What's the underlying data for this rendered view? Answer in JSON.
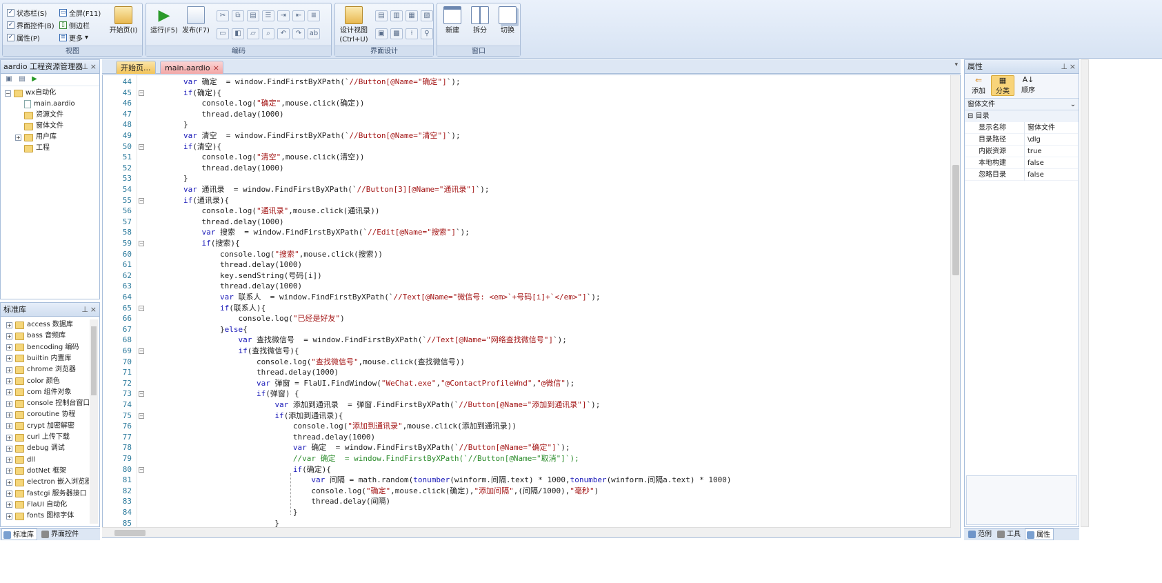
{
  "ribbon": {
    "view": {
      "title": "视图",
      "status_bar": "状态栏(S)",
      "fullscreen": "全屏(F11)",
      "ui_controls": "界面控件(B)",
      "sidebar": "侧边栏",
      "properties": "属性(P)",
      "more": "更多",
      "start_page": "开始页(I)"
    },
    "code": {
      "title": "编码",
      "run": "运行(F5)",
      "publish": "发布(F7)"
    },
    "design": {
      "title": "界面设计",
      "design_view": "设计视图",
      "design_view_key": "(Ctrl+U)"
    },
    "window": {
      "title": "窗口",
      "new": "新建",
      "split": "拆分",
      "switch": "切换"
    }
  },
  "project": {
    "title": "aardio 工程资源管理器",
    "root": "wx自动化",
    "items": [
      "main.aardio",
      "资源文件",
      "窗体文件",
      "用户库",
      "工程"
    ]
  },
  "stdlib": {
    "title": "标准库",
    "items": [
      "access 数据库",
      "bass 音频库",
      "bencoding 编码",
      "builtin 内置库",
      "chrome 浏览器",
      "color 颜色",
      "com 组件对象",
      "console 控制台窗口",
      "coroutine 协程",
      "crypt 加密解密",
      "curl 上传下载",
      "debug 调试",
      "dll",
      "dotNet 框架",
      "electron 嵌入浏览器",
      "fastcgi 服务器接口",
      "FlaUI 自动化",
      "fonts 图标字体"
    ],
    "tab_stdlib": "标准库",
    "tab_ui": "界面控件"
  },
  "tabs": [
    "开始页...",
    "main.aardio"
  ],
  "editor": {
    "lines": [
      {
        "n": 44,
        "fold": false,
        "html": "        <span class=\"kw\">var</span> 确定  = window.FindFirstByXPath(`<span class=\"str\">//Button[@Name=\"确定\"]</span>`);"
      },
      {
        "n": 45,
        "fold": true,
        "html": "        <span class=\"kw\">if</span>(确定){"
      },
      {
        "n": 46,
        "fold": false,
        "html": "            console.log(<span class=\"str\">\"确定\"</span>,mouse.click(确定))"
      },
      {
        "n": 47,
        "fold": false,
        "html": "            thread.delay(1000)"
      },
      {
        "n": 48,
        "fold": false,
        "html": "        }"
      },
      {
        "n": 49,
        "fold": false,
        "html": "        <span class=\"kw\">var</span> 清空  = window.FindFirstByXPath(`<span class=\"str\">//Button[@Name=\"清空\"]</span>`);"
      },
      {
        "n": 50,
        "fold": true,
        "html": "        <span class=\"kw\">if</span>(清空){"
      },
      {
        "n": 51,
        "fold": false,
        "html": "            console.log(<span class=\"str\">\"清空\"</span>,mouse.click(清空))"
      },
      {
        "n": 52,
        "fold": false,
        "html": "            thread.delay(1000)"
      },
      {
        "n": 53,
        "fold": false,
        "html": "        }"
      },
      {
        "n": 54,
        "fold": false,
        "html": "        <span class=\"kw\">var</span> 通讯录  = window.FindFirstByXPath(`<span class=\"str\">//Button[3][@Name=\"通讯录\"]</span>`);"
      },
      {
        "n": 55,
        "fold": true,
        "html": "        <span class=\"kw\">if</span>(通讯录){"
      },
      {
        "n": 56,
        "fold": false,
        "html": "            console.log(<span class=\"str\">\"通讯录\"</span>,mouse.click(通讯录))"
      },
      {
        "n": 57,
        "fold": false,
        "html": "            thread.delay(1000)"
      },
      {
        "n": 58,
        "fold": false,
        "html": "            <span class=\"kw\">var</span> 搜索  = window.FindFirstByXPath(`<span class=\"str\">//Edit[@Name=\"搜索\"]</span>`);"
      },
      {
        "n": 59,
        "fold": true,
        "html": "            <span class=\"kw\">if</span>(搜索){"
      },
      {
        "n": 60,
        "fold": false,
        "html": "                console.log(<span class=\"str\">\"搜索\"</span>,mouse.click(搜索))"
      },
      {
        "n": 61,
        "fold": false,
        "html": "                thread.delay(1000)"
      },
      {
        "n": 62,
        "fold": false,
        "html": "                key.sendString(号码[i])"
      },
      {
        "n": 63,
        "fold": false,
        "html": "                thread.delay(1000)"
      },
      {
        "n": 64,
        "fold": false,
        "html": "                <span class=\"kw\">var</span> 联系人  = window.FindFirstByXPath(`<span class=\"str\">//Text[@Name=\"微信号: &lt;em&gt;`+号码[i]+`&lt;/em&gt;\"]</span>`);"
      },
      {
        "n": 65,
        "fold": true,
        "html": "                <span class=\"kw\">if</span>(联系人){"
      },
      {
        "n": 66,
        "fold": false,
        "html": "                    console.log(<span class=\"str\">\"已经是好友\"</span>)"
      },
      {
        "n": 67,
        "fold": false,
        "html": "                }<span class=\"kw\">else</span>{"
      },
      {
        "n": 68,
        "fold": false,
        "html": "                    <span class=\"kw\">var</span> 查找微信号  = window.FindFirstByXPath(`<span class=\"str\">//Text[@Name=\"网络查找微信号\"]</span>`);"
      },
      {
        "n": 69,
        "fold": true,
        "html": "                    <span class=\"kw\">if</span>(查找微信号){"
      },
      {
        "n": 70,
        "fold": false,
        "html": "                        console.log(<span class=\"str\">\"查找微信号\"</span>,mouse.click(查找微信号))"
      },
      {
        "n": 71,
        "fold": false,
        "html": "                        thread.delay(1000)"
      },
      {
        "n": 72,
        "fold": false,
        "html": "                        <span class=\"kw\">var</span> 弹窗 = FlaUI.FindWindow(<span class=\"str\">\"WeChat.exe\"</span>,<span class=\"str\">\"@ContactProfileWnd\"</span>,<span class=\"str\">\"@微信\"</span>);"
      },
      {
        "n": 73,
        "fold": true,
        "html": "                        <span class=\"kw\">if</span>(弹窗) {"
      },
      {
        "n": 74,
        "fold": false,
        "html": "                            <span class=\"kw\">var</span> 添加到通讯录  = 弹窗.FindFirstByXPath(`<span class=\"str\">//Button[@Name=\"添加到通讯录\"]</span>`);"
      },
      {
        "n": 75,
        "fold": true,
        "html": "                            <span class=\"kw\">if</span>(添加到通讯录){"
      },
      {
        "n": 76,
        "fold": false,
        "html": "                                console.log(<span class=\"str\">\"添加到通讯录\"</span>,mouse.click(添加到通讯录))"
      },
      {
        "n": 77,
        "fold": false,
        "html": "                                thread.delay(1000)"
      },
      {
        "n": 78,
        "fold": false,
        "html": "                                <span class=\"kw\">var</span> 确定  = window.FindFirstByXPath(`<span class=\"str\">//Button[@Name=\"确定\"]</span>`);"
      },
      {
        "n": 79,
        "fold": false,
        "html": "                                <span class=\"cm\">//var 确定  = window.FindFirstByXPath(`//Button[@Name=\"取消\"]`);</span>"
      },
      {
        "n": 80,
        "fold": true,
        "html": "                                <span class=\"kw\">if</span>(确定){"
      },
      {
        "n": 81,
        "fold": false,
        "html": "                                    <span class=\"kw\">var</span> 间隔 = math.random(<span class=\"kw\">tonumber</span>(winform.间隔.text) * 1000,<span class=\"kw\">tonumber</span>(winform.间隔a.text) * 1000)"
      },
      {
        "n": 82,
        "fold": false,
        "html": "                                    console.log(<span class=\"str\">\"确定\"</span>,mouse.click(确定),<span class=\"str\">\"添加间隔\"</span>,(间隔/1000),<span class=\"str\">\"毫秒\"</span>)"
      },
      {
        "n": 83,
        "fold": false,
        "html": "                                    thread.delay(间隔)"
      },
      {
        "n": 84,
        "fold": false,
        "html": "                                }"
      },
      {
        "n": 85,
        "fold": false,
        "html": "                            }"
      }
    ]
  },
  "props": {
    "title": "属性",
    "add": "添加",
    "category": "分类",
    "order": "顺序",
    "selector": "窗体文件",
    "section": "目录",
    "rows": [
      {
        "k": "显示名称",
        "v": "窗体文件"
      },
      {
        "k": "目录路径",
        "v": "\\dlg"
      },
      {
        "k": "内嵌资源",
        "v": "true"
      },
      {
        "k": "本地构建",
        "v": "false"
      },
      {
        "k": "忽略目录",
        "v": "false"
      }
    ],
    "tab_samples": "范例",
    "tab_tools": "工具",
    "tab_props": "属性"
  }
}
